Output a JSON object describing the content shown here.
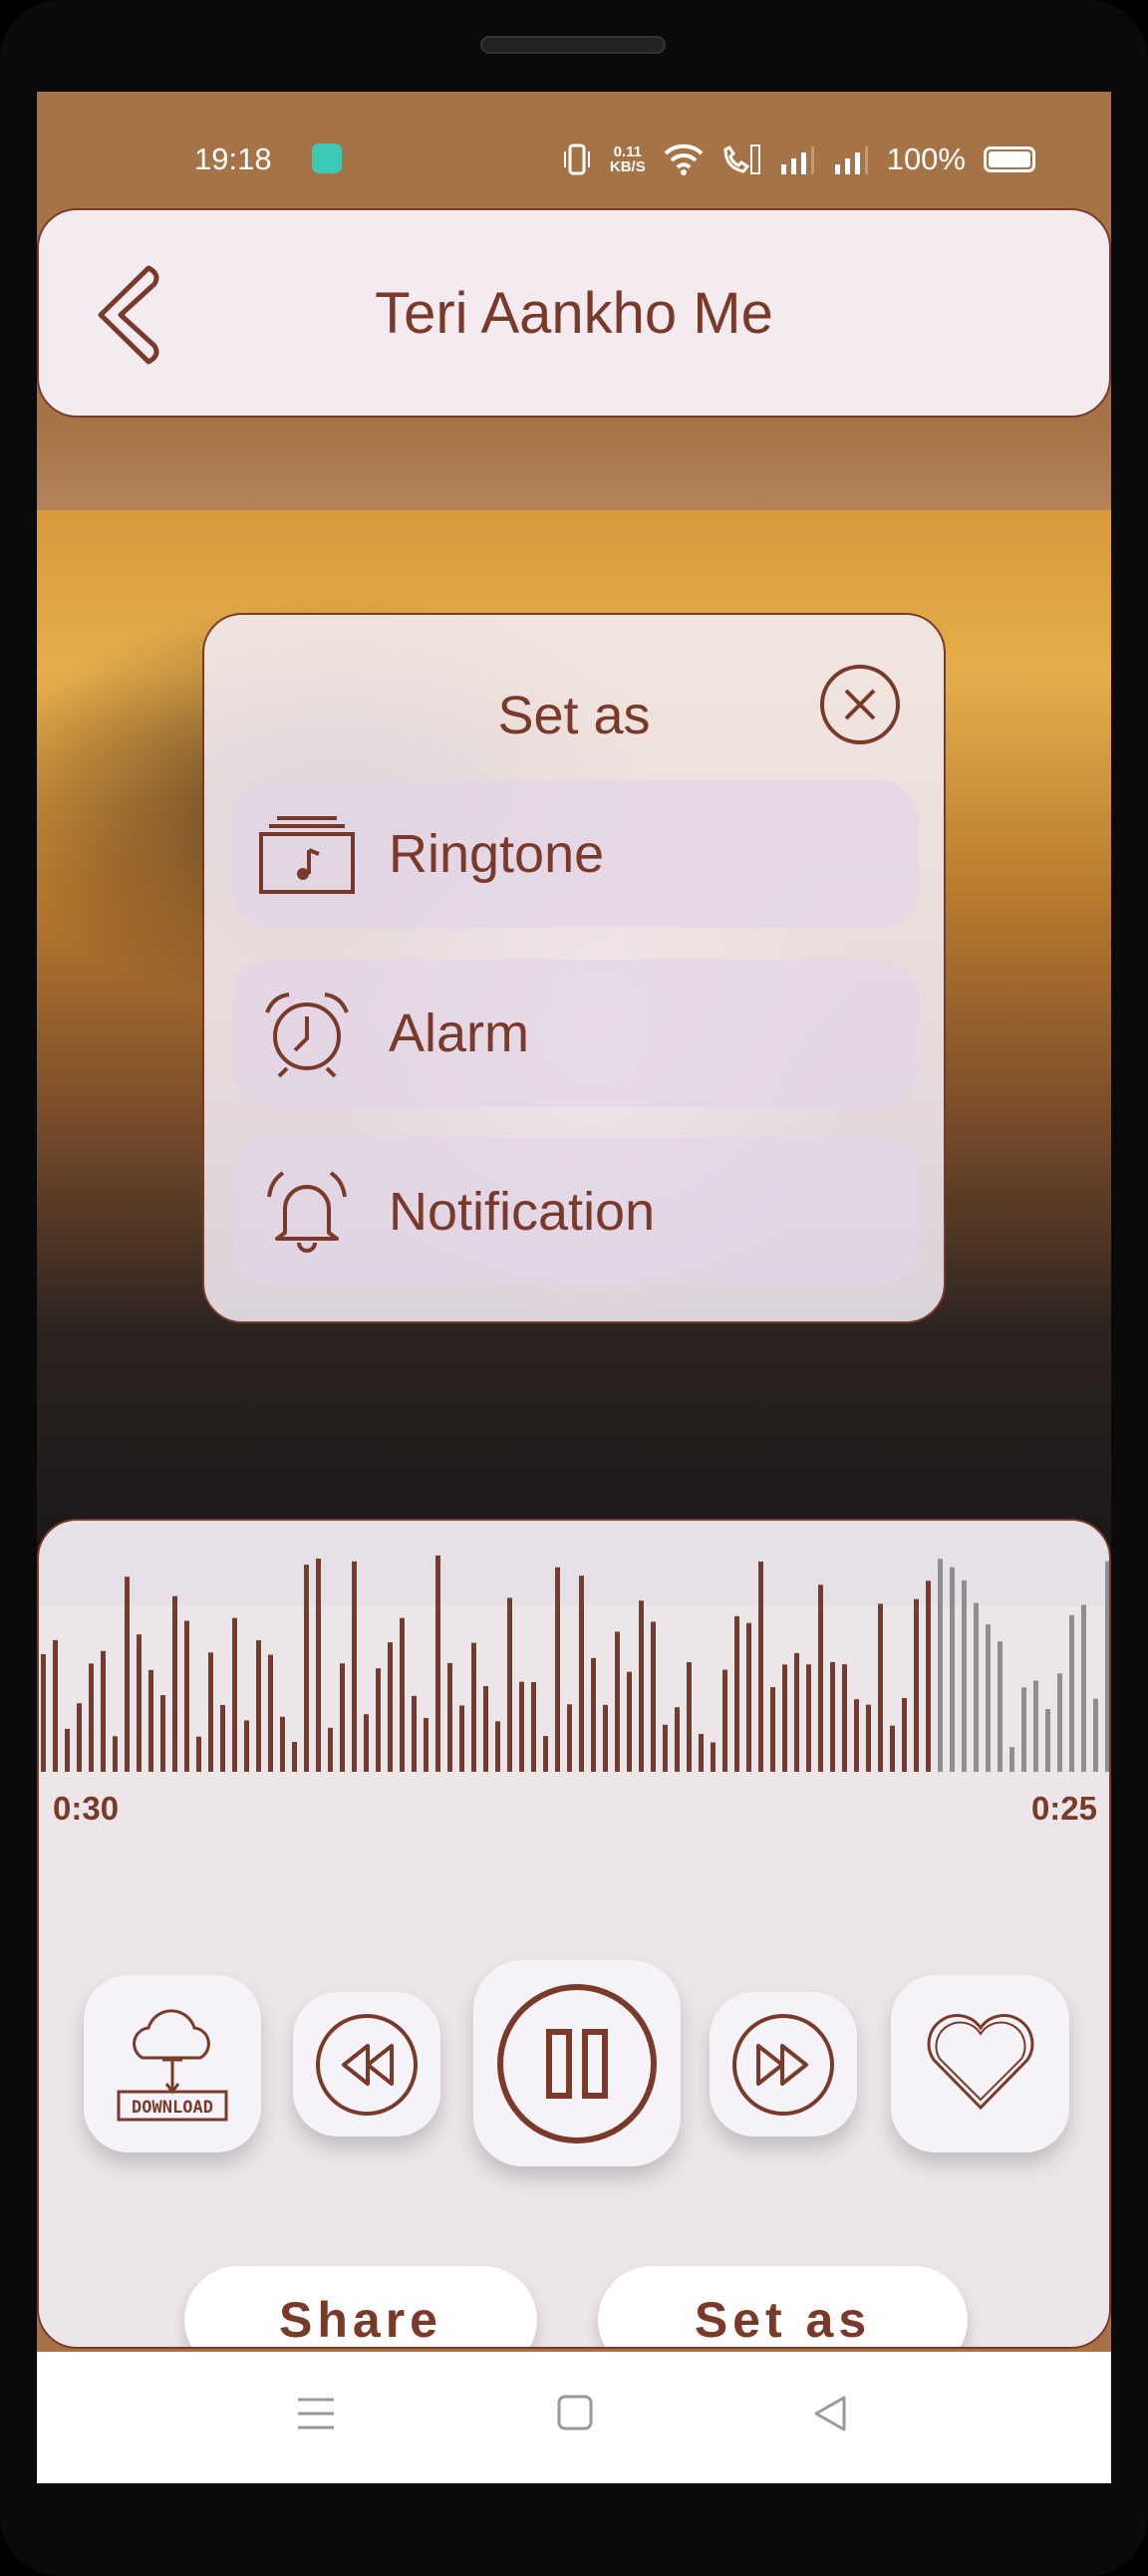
{
  "status_bar": {
    "time": "19:18",
    "net_speed": "0.11",
    "net_unit": "KB/S",
    "battery": "100%"
  },
  "header": {
    "title": "Teri Aankho Me",
    "back_icon": "chevron-left-icon"
  },
  "dialog": {
    "title": "Set as",
    "items": [
      {
        "label": "Ringtone",
        "icon": "ringtone-icon"
      },
      {
        "label": "Alarm",
        "icon": "alarm-clock-icon"
      },
      {
        "label": "Notification",
        "icon": "bell-icon"
      }
    ]
  },
  "player": {
    "elapsed": "0:30",
    "remaining": "0:25",
    "progress": 0.83,
    "played_color": "#7a3a2a",
    "unplayed_color": "#8e8e8e",
    "download_label": "DOWNLOAD"
  },
  "actions": {
    "share": "Share",
    "set_as": "Set as"
  },
  "colors": {
    "accent": "#7a3a2a",
    "status_bar": "#a57346"
  }
}
